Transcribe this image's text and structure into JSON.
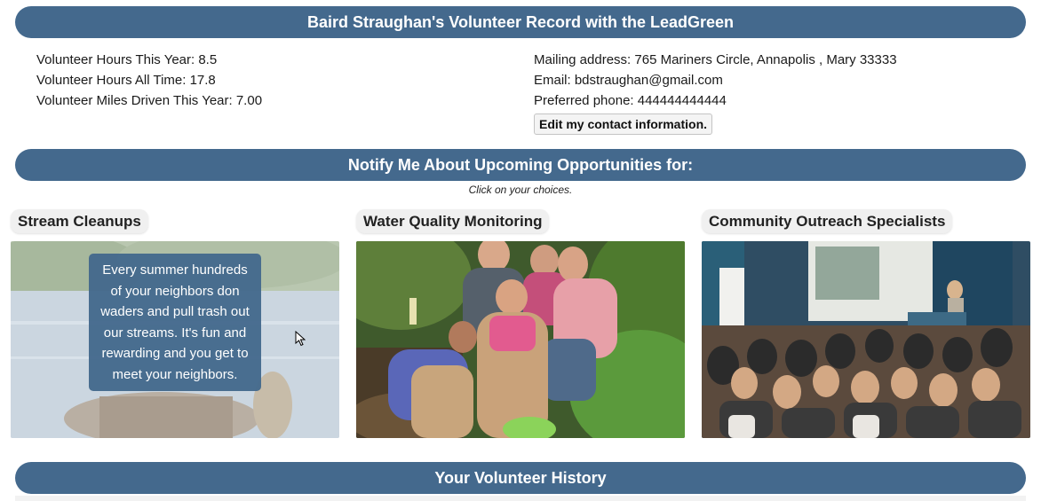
{
  "header": {
    "title": "Baird Straughan's Volunteer Record with the LeadGreen"
  },
  "stats": {
    "hours_this_year": "Volunteer Hours This Year: 8.5",
    "hours_all_time": "Volunteer Hours All Time: 17.8",
    "miles_this_year": "Volunteer Miles Driven This Year: 7.00"
  },
  "contact": {
    "mailing": "Mailing address: 765 Mariners Circle, Annapolis , Mary 33333",
    "email": "Email: bdstraughan@gmail.com",
    "phone": "Preferred phone: 444444444444",
    "edit_label": "Edit my contact information."
  },
  "notify": {
    "title": "Notify Me About Upcoming Opportunities for:",
    "hint": "Click on your choices."
  },
  "opportunities": [
    {
      "label": "Stream Cleanups",
      "description": "Every summer hundreds of your neighbors don waders and pull trash out our streams. It's fun and rewarding and you get to meet your neighbors."
    },
    {
      "label": "Water Quality Monitoring"
    },
    {
      "label": "Community Outreach Specialists"
    }
  ],
  "history": {
    "title": "Your Volunteer History"
  },
  "colors": {
    "accent": "#44698d",
    "text_on_accent": "#ffffff"
  },
  "icons": {
    "cursor": "arrow-cursor-icon"
  }
}
